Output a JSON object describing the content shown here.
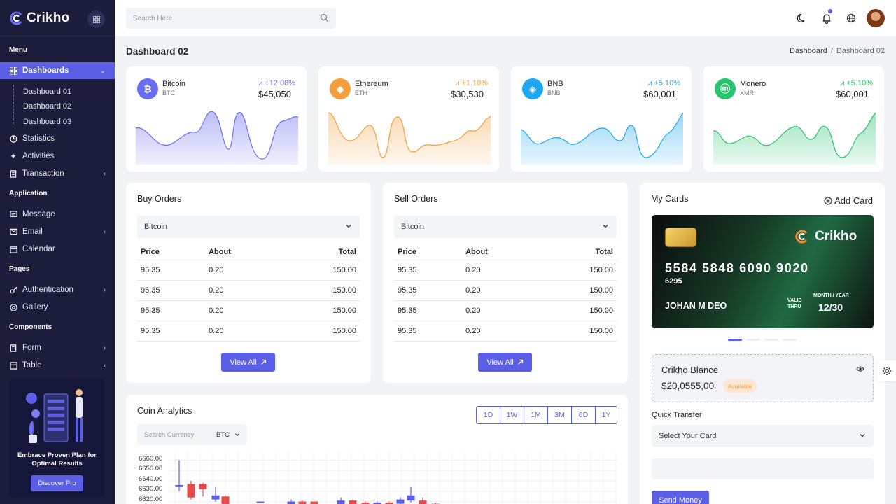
{
  "app": {
    "name": "Crikho"
  },
  "sidebar": {
    "sections": {
      "menu": "Menu",
      "application": "Application",
      "pages": "Pages",
      "components": "Components"
    },
    "dashboards": {
      "label": "Dashboards",
      "sub": [
        "Dashboard 01",
        "Dashboard 02",
        "Dashboard 03"
      ]
    },
    "items": {
      "statistics": "Statistics",
      "activities": "Activities",
      "transaction": "Transaction",
      "message": "Message",
      "email": "Email",
      "calendar": "Calendar",
      "authentication": "Authentication",
      "gallery": "Gallery",
      "form": "Form",
      "table": "Table"
    },
    "promo": {
      "text": "Embrace Proven Plan for Optimal Results",
      "button": "Discover Pro"
    }
  },
  "topbar": {
    "search_placeholder": "Search Here"
  },
  "page": {
    "title": "Dashboard 02",
    "breadcrumb": [
      "Dashboard",
      "Dashboard 02"
    ]
  },
  "coins": [
    {
      "name": "Bitcoin",
      "symbol": "BTC",
      "change": "+12.08%",
      "price": "$45,050",
      "color": "#6a6df0",
      "icon": "bitcoin-icon"
    },
    {
      "name": "Ethereum",
      "symbol": "ETH",
      "change": "+1.10%",
      "price": "$30,530",
      "color": "#f59e3b",
      "icon": "ethereum-icon"
    },
    {
      "name": "BNB",
      "symbol": "BNB",
      "change": "+5.10%",
      "price": "$60,001",
      "color": "#1ea6ef",
      "icon": "bnb-icon"
    },
    {
      "name": "Monero",
      "symbol": "XMR",
      "change": "+5.10%",
      "price": "$60,001",
      "color": "#27c36d",
      "icon": "monero-icon"
    }
  ],
  "buy_orders": {
    "title": "Buy Orders",
    "select": "Bitcoin",
    "headers": [
      "Price",
      "About",
      "Total"
    ],
    "rows": [
      [
        "95.35",
        "0.20",
        "150.00"
      ],
      [
        "95.35",
        "0.20",
        "150.00"
      ],
      [
        "95.35",
        "0.20",
        "150.00"
      ],
      [
        "95.35",
        "0.20",
        "150.00"
      ]
    ],
    "button": "View All"
  },
  "sell_orders": {
    "title": "Sell Orders",
    "select": "Bitcoin",
    "headers": [
      "Price",
      "About",
      "Total"
    ],
    "rows": [
      [
        "95.35",
        "0.20",
        "150.00"
      ],
      [
        "95.35",
        "0.20",
        "150.00"
      ],
      [
        "95.35",
        "0.20",
        "150.00"
      ],
      [
        "95.35",
        "0.20",
        "150.00"
      ]
    ],
    "button": "View All"
  },
  "analytics": {
    "title": "Coin Analytics",
    "ranges": [
      "1D",
      "1W",
      "1M",
      "3M",
      "6D",
      "1Y"
    ],
    "search_placeholder": "Search Currency",
    "currency": "BTC",
    "y_ticks": [
      "6660.00",
      "6650.00",
      "6640.00",
      "6630.00",
      "6620.00"
    ]
  },
  "chart_data": {
    "type": "candlestick",
    "title": "",
    "ylim": [
      6615,
      6665
    ],
    "y_ticks": [
      6660,
      6650,
      6640,
      6630,
      6620
    ],
    "candles": [
      {
        "o": 6634,
        "c": 6636,
        "h": 6660,
        "l": 6630,
        "color": "#5b5fe6"
      },
      {
        "o": 6637,
        "c": 6624,
        "h": 6640,
        "l": 6622,
        "color": "#e84b4b"
      },
      {
        "o": 6637,
        "c": 6632,
        "h": 6638,
        "l": 6625,
        "color": "#e84b4b"
      },
      {
        "o": 6626,
        "c": 6622,
        "h": 6634,
        "l": 6620,
        "color": "#5b5fe6"
      },
      {
        "o": 6625,
        "c": 6615,
        "h": 6626,
        "l": 6615,
        "color": "#e84b4b"
      },
      {
        "o": 6620,
        "c": 6620,
        "h": 6620,
        "l": 6619,
        "color": "#5b5fe6"
      },
      {
        "o": 6615,
        "c": 6620,
        "h": 6622,
        "l": 6615,
        "color": "#5b5fe6"
      },
      {
        "o": 6620,
        "c": 6615,
        "h": 6621,
        "l": 6615,
        "color": "#e84b4b"
      },
      {
        "o": 6617,
        "c": 6620,
        "h": 6620,
        "l": 6616,
        "color": "#e84b4b"
      },
      {
        "o": 6615,
        "c": 6621,
        "h": 6624,
        "l": 6615,
        "color": "#5b5fe6"
      },
      {
        "o": 6621,
        "c": 6617,
        "h": 6622,
        "l": 6616,
        "color": "#e84b4b"
      },
      {
        "o": 6619,
        "c": 6616,
        "h": 6620,
        "l": 6615,
        "color": "#e84b4b"
      },
      {
        "o": 6616,
        "c": 6619,
        "h": 6620,
        "l": 6615,
        "color": "#5b5fe6"
      },
      {
        "o": 6619,
        "c": 6616,
        "h": 6620,
        "l": 6615,
        "color": "#e84b4b"
      },
      {
        "o": 6622,
        "c": 6618,
        "h": 6624,
        "l": 6617,
        "color": "#5b5fe6"
      },
      {
        "o": 6621,
        "c": 6626,
        "h": 6634,
        "l": 6619,
        "color": "#5b5fe6"
      },
      {
        "o": 6621,
        "c": 6617,
        "h": 6624,
        "l": 6616,
        "color": "#e84b4b"
      },
      {
        "o": 6618,
        "c": 6615,
        "h": 6619,
        "l": 6615,
        "color": "#e84b4b"
      }
    ]
  },
  "my_cards": {
    "title": "My Cards",
    "add": "Add Card",
    "card": {
      "brand": "Crikho",
      "number": "5584 5848 6090 9020",
      "cvv": "6295",
      "holder": "JOHAN M DEO",
      "valid": "VALID",
      "thru": "THRU",
      "expiry_label": "MONTH / YEAR",
      "expiry": "12/30"
    },
    "balance": {
      "label": "Crikho Blance",
      "value": "$20,0555,00",
      "badge": "Available"
    },
    "quick_transfer": "Quick Transfer",
    "select_card": "Select Your Card",
    "send": "Send Money"
  },
  "colors": {
    "accent": "#5b5fe6",
    "sidebar": "#1b1d3b",
    "up": "#5b5fe6",
    "down": "#e84b4b"
  }
}
